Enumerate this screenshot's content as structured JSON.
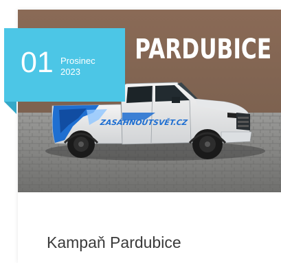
{
  "hero": {
    "location_title": "PARDUBICE",
    "vehicle_decal": "ZASÁHNOUTSVĚT.CZ"
  },
  "date_badge": {
    "day": "01",
    "month": "Prosinec",
    "year": "2023",
    "color": "#4cc6e6"
  },
  "card": {
    "title": "Kampaň Pardubice"
  }
}
